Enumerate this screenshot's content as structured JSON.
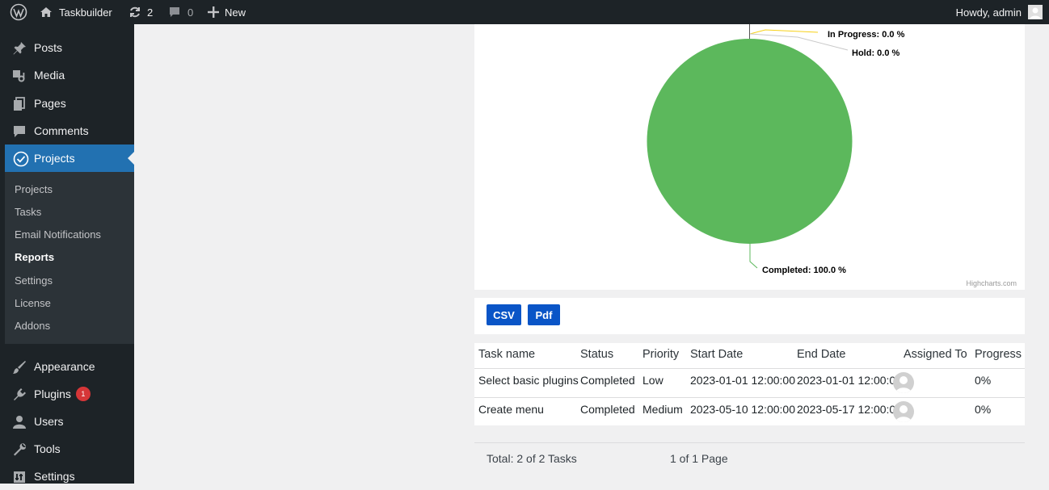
{
  "admin_bar": {
    "site_name": "Taskbuilder",
    "updates_count": "2",
    "comments_count": "0",
    "new_label": "New",
    "greeting": "Howdy, admin"
  },
  "sidebar": {
    "items": [
      {
        "label": "Posts",
        "icon": "pushpin-icon"
      },
      {
        "label": "Media",
        "icon": "media-icon"
      },
      {
        "label": "Pages",
        "icon": "pages-icon"
      },
      {
        "label": "Comments",
        "icon": "comment-bubble-icon"
      },
      {
        "label": "Projects",
        "icon": "check-circle-icon"
      },
      {
        "label": "Appearance",
        "icon": "paintbrush-icon"
      },
      {
        "label": "Plugins",
        "icon": "plugin-icon",
        "badge": "1"
      },
      {
        "label": "Users",
        "icon": "user-icon"
      },
      {
        "label": "Tools",
        "icon": "wrench-icon"
      },
      {
        "label": "Settings",
        "icon": "settings-icon"
      }
    ],
    "submenu": [
      "Projects",
      "Tasks",
      "Email Notifications",
      "Reports",
      "Settings",
      "License",
      "Addons"
    ],
    "current_submenu": "Reports"
  },
  "chart_data": {
    "type": "pie",
    "slices": [
      {
        "name": "In Progress",
        "value": 0.0,
        "label": "In Progress: 0.0 %",
        "color": "#f7d117"
      },
      {
        "name": "Hold",
        "value": 0.0,
        "label": "Hold: 0.0 %",
        "color": "#c9c9c9"
      },
      {
        "name": "Completed",
        "value": 100.0,
        "label": "Completed: 100.0 %",
        "color": "#5cb85c"
      }
    ],
    "credit": "Highcharts.com"
  },
  "export": {
    "csv_label": "CSV",
    "pdf_label": "Pdf"
  },
  "table": {
    "headers": [
      "Task name",
      "Status",
      "Priority",
      "Start Date",
      "End Date",
      "Assigned To",
      "Progress"
    ],
    "rows": [
      [
        "Select basic plugins",
        "Completed",
        "Low",
        "2023-01-01 12:00:00",
        "2023-01-01 12:00:00",
        "",
        "0%"
      ],
      [
        "Create menu",
        "Completed",
        "Medium",
        "2023-05-10 12:00:00",
        "2023-05-17 12:00:00",
        "",
        "0%"
      ]
    ]
  },
  "footer": {
    "total": "Total: 2 of 2 Tasks",
    "pages": "1 of 1 Page"
  },
  "colors": {
    "accent": "#2271b1",
    "button": "#0a55c7",
    "badge": "#d63638",
    "admin_bg": "#1d2327"
  }
}
